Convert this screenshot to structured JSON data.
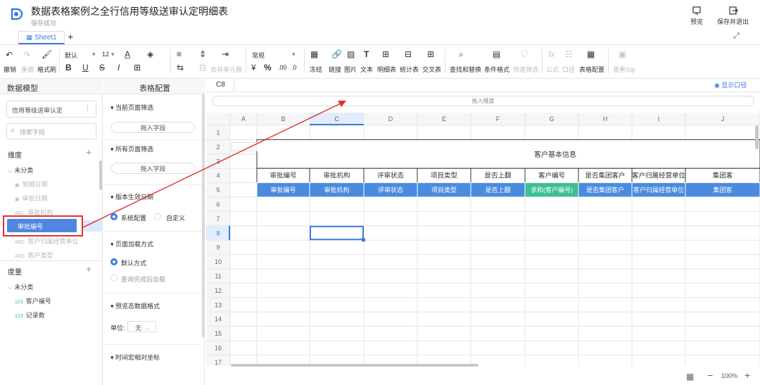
{
  "header": {
    "title": "数据表格案例之全行信用等级送审认定明细表",
    "status": "保存成功",
    "preview_label": "预览",
    "save_exit_label": "保存并退出"
  },
  "sheet": {
    "tab_label": "Sheet1",
    "add_label": "+"
  },
  "toolbar": {
    "undo": "撤销",
    "redo": "重做",
    "format_painter": "格式刷",
    "font_name": "默认",
    "font_size": "12",
    "merge": "合并单元格",
    "number_format": "常规",
    "freeze": "冻结",
    "link": "链接",
    "image": "图片",
    "text": "文本",
    "detail_table": "明细表",
    "stat_table": "统计表",
    "cross_table": "交叉表",
    "find_replace": "查找和替换",
    "cond_format": "条件格式",
    "quick_filter": "快速筛选",
    "formula": "公式",
    "caliber": "口径",
    "table_config": "表格配置",
    "view_sql": "查看Sql"
  },
  "left_panel": {
    "title": "数据模型",
    "dataset": "信用等级送审认定",
    "search_placeholder": "搜索字段",
    "dimensions_label": "维度",
    "dimension_group": "未分类",
    "dimension_fields": [
      {
        "label": "到期日期",
        "icon": "calendar"
      },
      {
        "label": "审批日期",
        "icon": "calendar"
      },
      {
        "label": "审批机构",
        "icon": "abc"
      },
      {
        "label": "审批编号",
        "icon": "abc"
      },
      {
        "label": "客户归属经营单位",
        "icon": "abc"
      },
      {
        "label": "客户类型",
        "icon": "abc"
      }
    ],
    "dragging_field": "审批编号",
    "measures_label": "度量",
    "measure_group": "未分类",
    "measure_fields": [
      {
        "label": "客户编号",
        "icon": "123"
      },
      {
        "label": "记录数",
        "icon": "123"
      }
    ]
  },
  "config_panel": {
    "title": "表格配置",
    "current_filter": "当前页面筛选",
    "insert_field": "拖入字段",
    "all_filter": "所有页面筛选",
    "version_date": "版本生效日期",
    "sys_config": "系统配置",
    "custom": "自定义",
    "load_mode": "页面加载方式",
    "default_mode": "默认方式",
    "load_after_query": "查询完成后加载",
    "preview_format": "预览态数据格式",
    "unit_label": "单位:",
    "unit_value": "无",
    "time_macro": "时间宏相对坐标"
  },
  "sheet_area": {
    "cell_ref": "C8",
    "show_caliber": "显示口径",
    "insert_dim": "拖入维度",
    "columns": [
      "A",
      "B",
      "C",
      "D",
      "E",
      "F",
      "G",
      "H",
      "I",
      "J"
    ],
    "rows": [
      "1",
      "2",
      "3",
      "4",
      "5",
      "6",
      "7",
      "8",
      "9",
      "10",
      "11",
      "12",
      "13",
      "14",
      "15",
      "16",
      "17"
    ],
    "merged_title": "客户基本信息",
    "headers": [
      "审批编号",
      "审批机构",
      "评审状态",
      "项目类型",
      "是否上翻",
      "客户编号",
      "是否集团客户",
      "客户归属经营单位",
      "集团客"
    ],
    "bindings": [
      "审批编号",
      "审批机构",
      "评审状态",
      "项目类型",
      "是否上翻",
      "求和(客户编号)",
      "是否集团客户",
      "客户归属经营单位",
      "集团客"
    ],
    "zoom": "100%"
  },
  "colors": {
    "accent": "#3b7be0",
    "binding_blue": "#4a8be0",
    "binding_green": "#3cbf96",
    "arrow_red": "#e03030"
  }
}
